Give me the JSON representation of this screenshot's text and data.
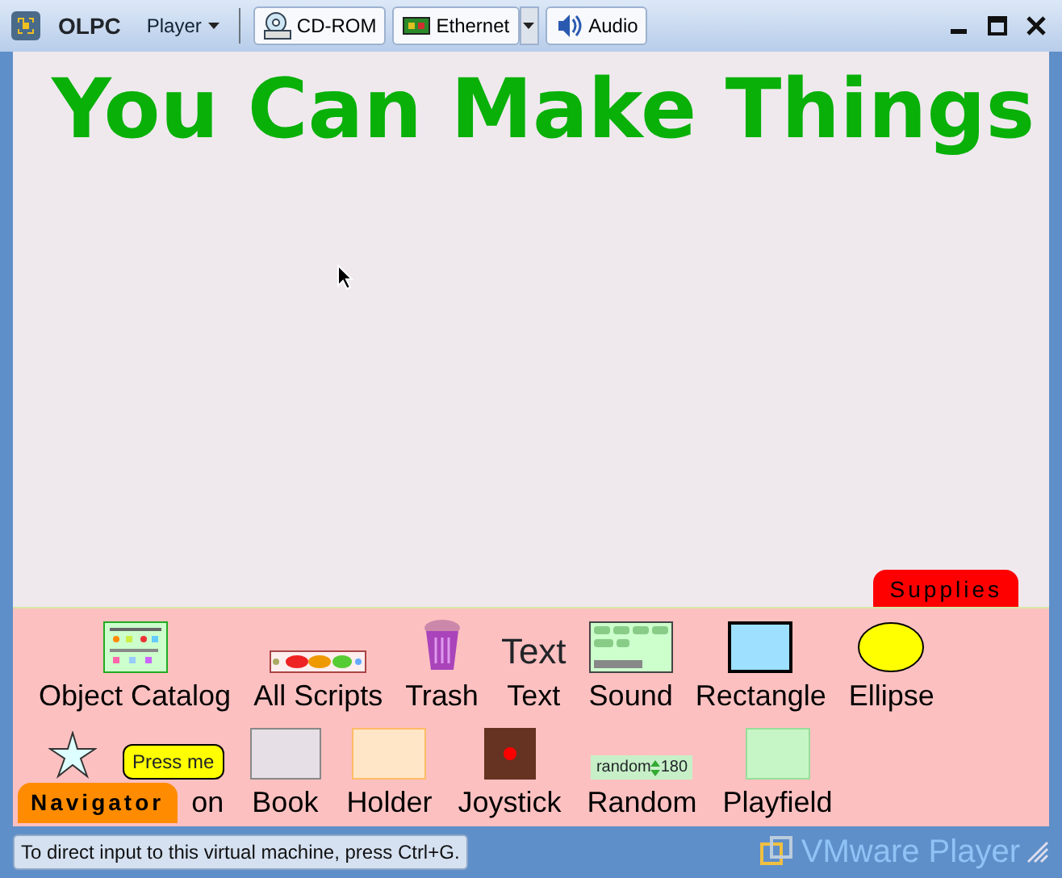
{
  "window": {
    "app_name": "OLPC",
    "menu": "Player"
  },
  "toolbar": [
    {
      "label": "CD-ROM",
      "kind": "disk",
      "dropdown": false
    },
    {
      "label": "Ethernet",
      "kind": "network",
      "dropdown": true
    },
    {
      "label": "Audio",
      "kind": "audio",
      "dropdown": false
    }
  ],
  "heading": "You Can Make Things",
  "supplies": {
    "tab": "Supplies",
    "top_row": [
      {
        "kind": "catalog",
        "label": "Object Catalog"
      },
      {
        "kind": "scripts",
        "label": "All Scripts"
      },
      {
        "kind": "trash",
        "label": "Trash"
      },
      {
        "kind": "text",
        "preview": "Text",
        "label": "Text"
      },
      {
        "kind": "sound",
        "label": "Sound"
      },
      {
        "kind": "rectangle",
        "label": "Rectangle"
      },
      {
        "kind": "ellipse",
        "label": "Ellipse"
      }
    ],
    "bottom_row": [
      {
        "kind": "star"
      },
      {
        "kind": "button",
        "preview": "Press me",
        "label": "on"
      },
      {
        "kind": "book",
        "label": "Book"
      },
      {
        "kind": "holder",
        "label": "Holder"
      },
      {
        "kind": "joystick",
        "label": "Joystick"
      },
      {
        "kind": "random",
        "preview": "random",
        "value": "180",
        "label": "Random"
      },
      {
        "kind": "playfield",
        "label": "Playfield"
      }
    ]
  },
  "navigator": {
    "tab": "Navigator"
  },
  "status_bar": {
    "message": "To direct input to this virtual machine, press Ctrl+G.",
    "brand": "VMware Player"
  }
}
